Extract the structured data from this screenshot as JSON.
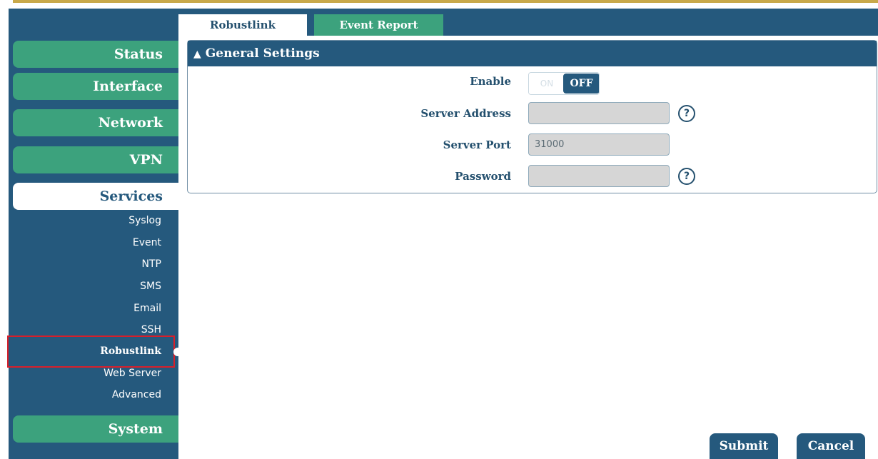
{
  "sidebar": {
    "menu": [
      {
        "label": "Status"
      },
      {
        "label": "Interface"
      },
      {
        "label": "Network"
      },
      {
        "label": "VPN"
      },
      {
        "label": "Services",
        "active": true
      },
      {
        "label": "System"
      }
    ],
    "services_items": [
      {
        "label": "Syslog"
      },
      {
        "label": "Event"
      },
      {
        "label": "NTP"
      },
      {
        "label": "SMS"
      },
      {
        "label": "Email"
      },
      {
        "label": "SSH"
      },
      {
        "label": "Robustlink",
        "selected": true
      },
      {
        "label": "Web Server"
      },
      {
        "label": "Advanced"
      }
    ]
  },
  "tabs": [
    {
      "label": "Robustlink",
      "active": true
    },
    {
      "label": "Event Report",
      "active": false
    }
  ],
  "panel": {
    "title": "General Settings",
    "fields": {
      "enable": {
        "label": "Enable",
        "on_label": "ON",
        "off_label": "OFF",
        "state": "off"
      },
      "server_address": {
        "label": "Server Address",
        "value": ""
      },
      "server_port": {
        "label": "Server Port",
        "value": "31000"
      },
      "password": {
        "label": "Password",
        "value": ""
      }
    }
  },
  "actions": {
    "submit": "Submit",
    "cancel": "Cancel"
  },
  "colors": {
    "primary": "#25597d",
    "accent": "#3ca27d",
    "highlight": "#d81f2a"
  }
}
